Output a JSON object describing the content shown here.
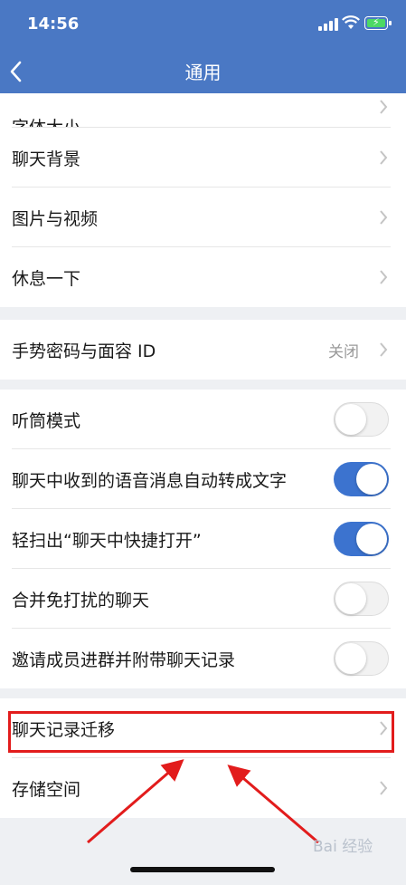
{
  "status_bar": {
    "time": "14:56"
  },
  "header": {
    "title": "通用"
  },
  "sections": [
    {
      "rows": [
        {
          "label": "字体大小",
          "type": "nav"
        },
        {
          "label": "聊天背景",
          "type": "nav"
        },
        {
          "label": "图片与视频",
          "type": "nav"
        },
        {
          "label": "休息一下",
          "type": "nav"
        }
      ]
    },
    {
      "rows": [
        {
          "label": "手势密码与面容 ID",
          "value": "关闭",
          "type": "nav"
        }
      ]
    },
    {
      "rows": [
        {
          "label": "听筒模式",
          "type": "toggle",
          "on": false
        },
        {
          "label": "聊天中收到的语音消息自动转成文字",
          "type": "toggle",
          "on": true
        },
        {
          "label": "轻扫出“聊天中快捷打开”",
          "type": "toggle",
          "on": true
        },
        {
          "label": "合并免打扰的聊天",
          "type": "toggle",
          "on": false
        },
        {
          "label": "邀请成员进群并附带聊天记录",
          "type": "toggle",
          "on": false
        }
      ]
    },
    {
      "rows": [
        {
          "label": "聊天记录迁移",
          "type": "nav"
        },
        {
          "label": "存储空间",
          "type": "nav"
        }
      ]
    }
  ],
  "colors": {
    "header_bg": "#4a78c4",
    "toggle_on": "#3c73cf",
    "highlight": "#e21c1c"
  },
  "watermark": "Bai 经验"
}
